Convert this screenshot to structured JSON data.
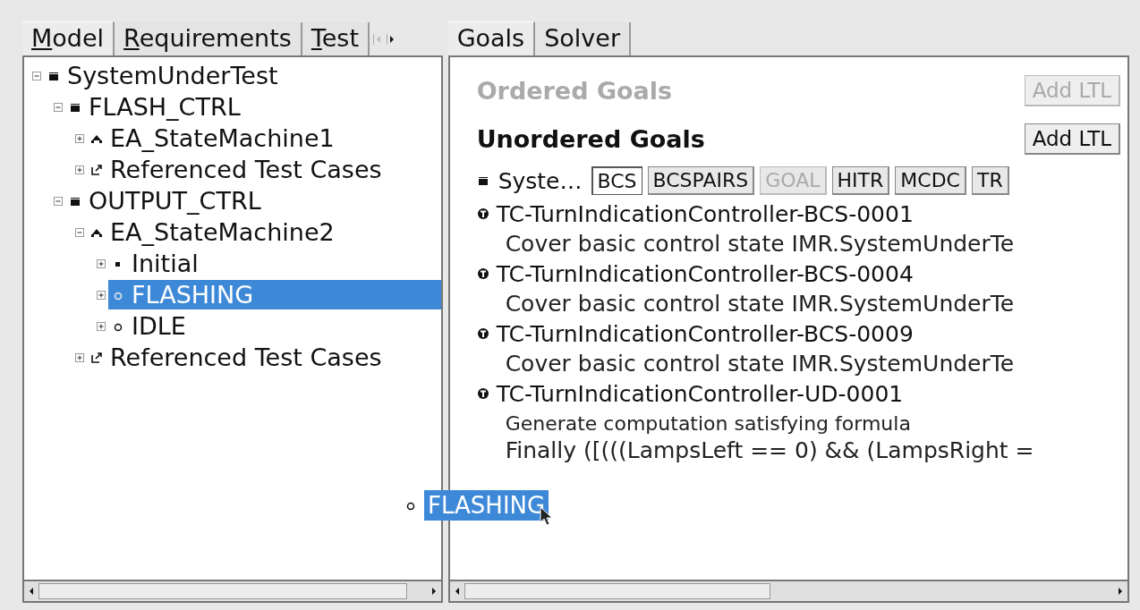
{
  "left_tabs": [
    {
      "label": "Model",
      "selected": true
    },
    {
      "label": "Requirements",
      "selected": false
    },
    {
      "label": "Test",
      "selected": false
    }
  ],
  "tree": [
    {
      "label": "SystemUnderTest",
      "kind": "component",
      "expanded": true,
      "selected": false,
      "children": [
        {
          "label": "FLASH_CTRL",
          "kind": "component",
          "expanded": true,
          "selected": false,
          "children": [
            {
              "label": "EA_StateMachine1",
              "kind": "state_machine",
              "expanded": false,
              "selected": false
            },
            {
              "label": "Referenced Test Cases",
              "kind": "test_cases",
              "expanded": false,
              "selected": false
            }
          ]
        },
        {
          "label": "OUTPUT_CTRL",
          "kind": "component",
          "expanded": true,
          "selected": false,
          "children": [
            {
              "label": "EA_StateMachine2",
              "kind": "state_machine",
              "expanded": true,
              "selected": false,
              "children": [
                {
                  "label": "Initial",
                  "kind": "initial",
                  "expanded": false,
                  "selected": false
                },
                {
                  "label": "FLASHING",
                  "kind": "state",
                  "expanded": false,
                  "selected": true
                },
                {
                  "label": "IDLE",
                  "kind": "state",
                  "expanded": false,
                  "selected": false
                }
              ]
            },
            {
              "label": "Referenced Test Cases",
              "kind": "test_cases",
              "expanded": false,
              "selected": false
            }
          ]
        }
      ]
    }
  ],
  "drag_item": {
    "label": "FLASHING",
    "kind": "state"
  },
  "right_tabs": [
    {
      "label": "Goals",
      "selected": true
    },
    {
      "label": "Solver",
      "selected": false
    }
  ],
  "ordered_goals": {
    "title": "Ordered Goals",
    "disabled": true,
    "button": {
      "label": "Add LTL",
      "disabled": true
    }
  },
  "unordered_goals": {
    "title": "Unordered Goals",
    "disabled": false,
    "button": {
      "label": "Add LTL",
      "disabled": false
    }
  },
  "component_row": {
    "label": "Syste…",
    "buttons": [
      {
        "label": "BCS",
        "selected": true,
        "disabled": false
      },
      {
        "label": "BCSPAIRS",
        "selected": false,
        "disabled": false
      },
      {
        "label": "GOAL",
        "selected": false,
        "disabled": true
      },
      {
        "label": "HITR",
        "selected": false,
        "disabled": false
      },
      {
        "label": "MCDC",
        "selected": false,
        "disabled": false
      },
      {
        "label": "TR",
        "selected": false,
        "disabled": false
      }
    ]
  },
  "goals": [
    {
      "title": "TC-TurnIndicationController-BCS-0001",
      "lines": [
        "Cover basic control state IMR.SystemUnderTe"
      ]
    },
    {
      "title": "TC-TurnIndicationController-BCS-0004",
      "lines": [
        "Cover basic control state IMR.SystemUnderTe"
      ]
    },
    {
      "title": "TC-TurnIndicationController-BCS-0009",
      "lines": [
        "Cover basic control state IMR.SystemUnderTe"
      ]
    },
    {
      "title": "TC-TurnIndicationController-UD-0001",
      "lines": [
        "Generate computation satisfying formula",
        "Finally ([(((LampsLeft == 0) && (LampsRight ="
      ]
    }
  ]
}
